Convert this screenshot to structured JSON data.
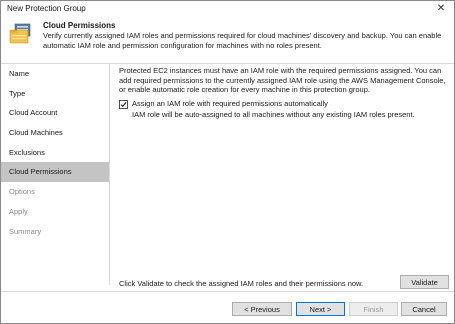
{
  "window": {
    "title": "New Protection Group",
    "close_glyph": "✕"
  },
  "header": {
    "title": "Cloud Permissions",
    "description": "Verify currently assigned IAM roles and permissions required for cloud machines' discovery and backup. You can enable automatic IAM role and permission configuration for machines with no roles present."
  },
  "sidebar": {
    "items": [
      {
        "label": "Name",
        "state": "normal"
      },
      {
        "label": "Type",
        "state": "normal"
      },
      {
        "label": "Cloud Account",
        "state": "normal"
      },
      {
        "label": "Cloud Machines",
        "state": "normal"
      },
      {
        "label": "Exclusions",
        "state": "normal"
      },
      {
        "label": "Cloud Permissions",
        "state": "active"
      },
      {
        "label": "Options",
        "state": "disabled"
      },
      {
        "label": "Apply",
        "state": "disabled"
      },
      {
        "label": "Summary",
        "state": "disabled"
      }
    ]
  },
  "content": {
    "paragraph": "Protected EC2 instances must have an IAM role with the required permissions assigned. You can add required permissions to the currently assigned IAM role using the AWS Management Console, or enable automatic role creation for every machine in this protection group.",
    "checkbox_label": "Assign an IAM role with required permissions automatically",
    "checkbox_checked": true,
    "sub_note": "IAM role will be auto-assigned to all machines without any existing IAM roles present.",
    "validate_text": "Click Validate to check the assigned IAM roles and their permissions now.",
    "validate_button": "Validate"
  },
  "footer": {
    "previous": "< Previous",
    "next": "Next >",
    "finish": "Finish",
    "cancel": "Cancel"
  },
  "colors": {
    "active_item_bg": "#c4c4c4",
    "primary_border": "#0078d7"
  },
  "icons": {
    "header": "protection-group-icon",
    "close": "close-icon",
    "check": "check-icon"
  }
}
